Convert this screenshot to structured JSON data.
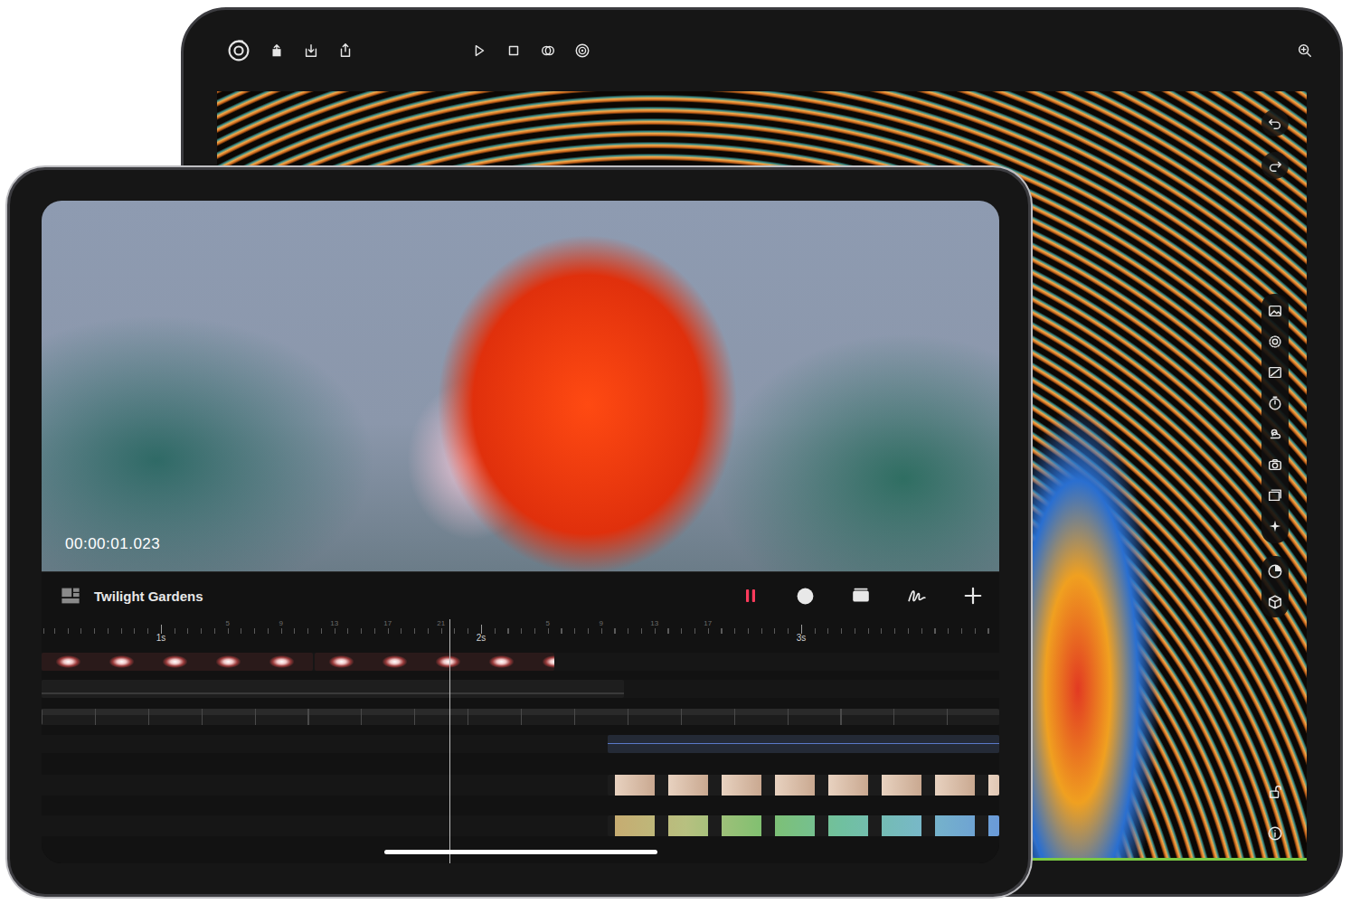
{
  "front_device": {
    "timecode": "00:00:01.023",
    "timeline": {
      "title": "Twilight Gardens",
      "playing": true,
      "seconds": [
        "1s",
        "2s",
        "3s"
      ],
      "frame_groups": [
        [
          "5",
          "9",
          "13",
          "17",
          "21"
        ],
        [
          "5",
          "9",
          "13",
          "17"
        ]
      ],
      "playhead": {
        "level": 0.426
      },
      "tracks": [
        {
          "kind": "glow"
        },
        {
          "kind": "keys"
        },
        {
          "kind": "bar"
        },
        {
          "kind": "lines"
        },
        {
          "kind": "skin"
        },
        {
          "kind": "spectrum"
        }
      ]
    }
  },
  "back_device": {
    "locked": false
  }
}
